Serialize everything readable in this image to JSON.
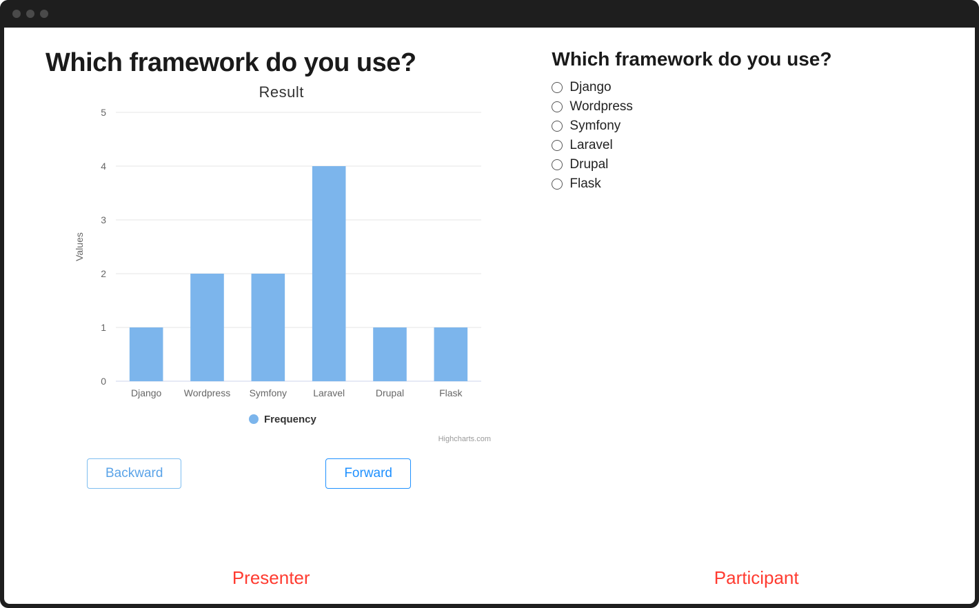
{
  "presenter": {
    "question": "Which framework do you use?",
    "nav": {
      "back": "Backward",
      "forward": "Forward"
    },
    "role_label": "Presenter"
  },
  "participant": {
    "question": "Which framework do you use?",
    "options": [
      "Django",
      "Wordpress",
      "Symfony",
      "Laravel",
      "Drupal",
      "Flask"
    ],
    "role_label": "Participant"
  },
  "chart_data": {
    "type": "bar",
    "title": "Result",
    "ylabel": "Values",
    "ylim": [
      0,
      5
    ],
    "yticks": [
      0,
      1,
      2,
      3,
      4,
      5
    ],
    "categories": [
      "Django",
      "Wordpress",
      "Symfony",
      "Laravel",
      "Drupal",
      "Flask"
    ],
    "series": [
      {
        "name": "Frequency",
        "values": [
          1,
          2,
          2,
          4,
          1,
          1
        ]
      }
    ],
    "credits": "Highcharts.com"
  }
}
